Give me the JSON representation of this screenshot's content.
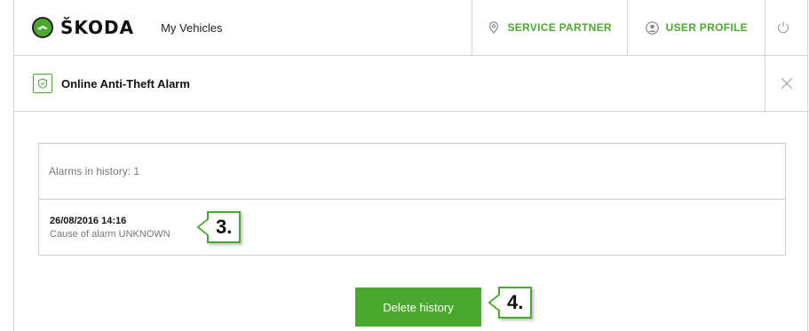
{
  "header": {
    "brand": "ŠKODA",
    "nav_title": "My Vehicles",
    "service_partner": "SERVICE PARTNER",
    "user_profile": "USER PROFILE"
  },
  "panel": {
    "title": "Online Anti-Theft Alarm",
    "history_count_text": "Alarms in history: 1",
    "alarms": [
      {
        "datetime": "26/08/2016 14:16",
        "cause": "Cause of alarm UNKNOWN"
      }
    ]
  },
  "actions": {
    "delete_label": "Delete history"
  },
  "callouts": {
    "step3": "3.",
    "step4": "4."
  },
  "colors": {
    "accent": "#4ba82e",
    "border": "#d3d3d3",
    "muted_text": "#777777"
  },
  "icons": {
    "logo": "skoda-logo-icon",
    "service_partner": "location-pin-icon",
    "user_profile": "user-icon",
    "power": "power-icon",
    "alarm": "shield-icon",
    "close": "close-icon"
  }
}
